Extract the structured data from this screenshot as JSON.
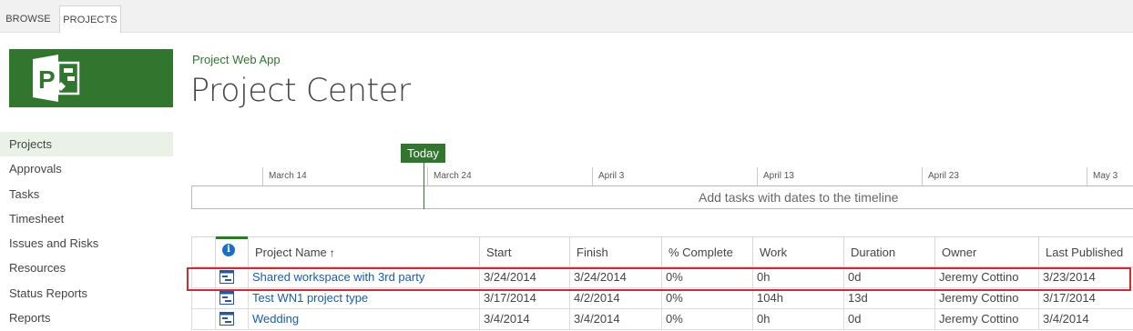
{
  "ribbon": {
    "tabs": [
      "BROWSE",
      "PROJECTS"
    ]
  },
  "site_title": "Project Web App",
  "page_title": "Project Center",
  "colors": {
    "brand": "#31752f",
    "link": "#1a5ea8",
    "highlight": "#d32a2f"
  },
  "nav": {
    "items": [
      "Projects",
      "Approvals",
      "Tasks",
      "Timesheet",
      "Issues and Risks",
      "Resources",
      "Status Reports",
      "Reports"
    ],
    "selected": "Projects"
  },
  "timeline": {
    "today_label": "Today",
    "dates": [
      "March 14",
      "March 24",
      "April 3",
      "April 13",
      "April 23",
      "May 3"
    ],
    "empty_message": "Add tasks with dates to the timeline"
  },
  "grid": {
    "columns": [
      "Project Name",
      "Start",
      "Finish",
      "% Complete",
      "Work",
      "Duration",
      "Owner",
      "Last Published"
    ],
    "sort_indicator": "↑",
    "rows": [
      {
        "name": "Shared workspace with 3rd party",
        "start": "3/24/2014",
        "finish": "3/24/2014",
        "complete": "0%",
        "work": "0h",
        "duration": "0d",
        "owner": "Jeremy Cottino",
        "published": "3/23/2014"
      },
      {
        "name": "Test WN1 project type",
        "start": "3/17/2014",
        "finish": "4/2/2014",
        "complete": "0%",
        "work": "104h",
        "duration": "13d",
        "owner": "Jeremy Cottino",
        "published": "3/17/2014"
      },
      {
        "name": "Wedding",
        "start": "3/4/2014",
        "finish": "3/4/2014",
        "complete": "0%",
        "work": "0h",
        "duration": "0d",
        "owner": "Jeremy Cottino",
        "published": "3/4/2014"
      }
    ]
  }
}
